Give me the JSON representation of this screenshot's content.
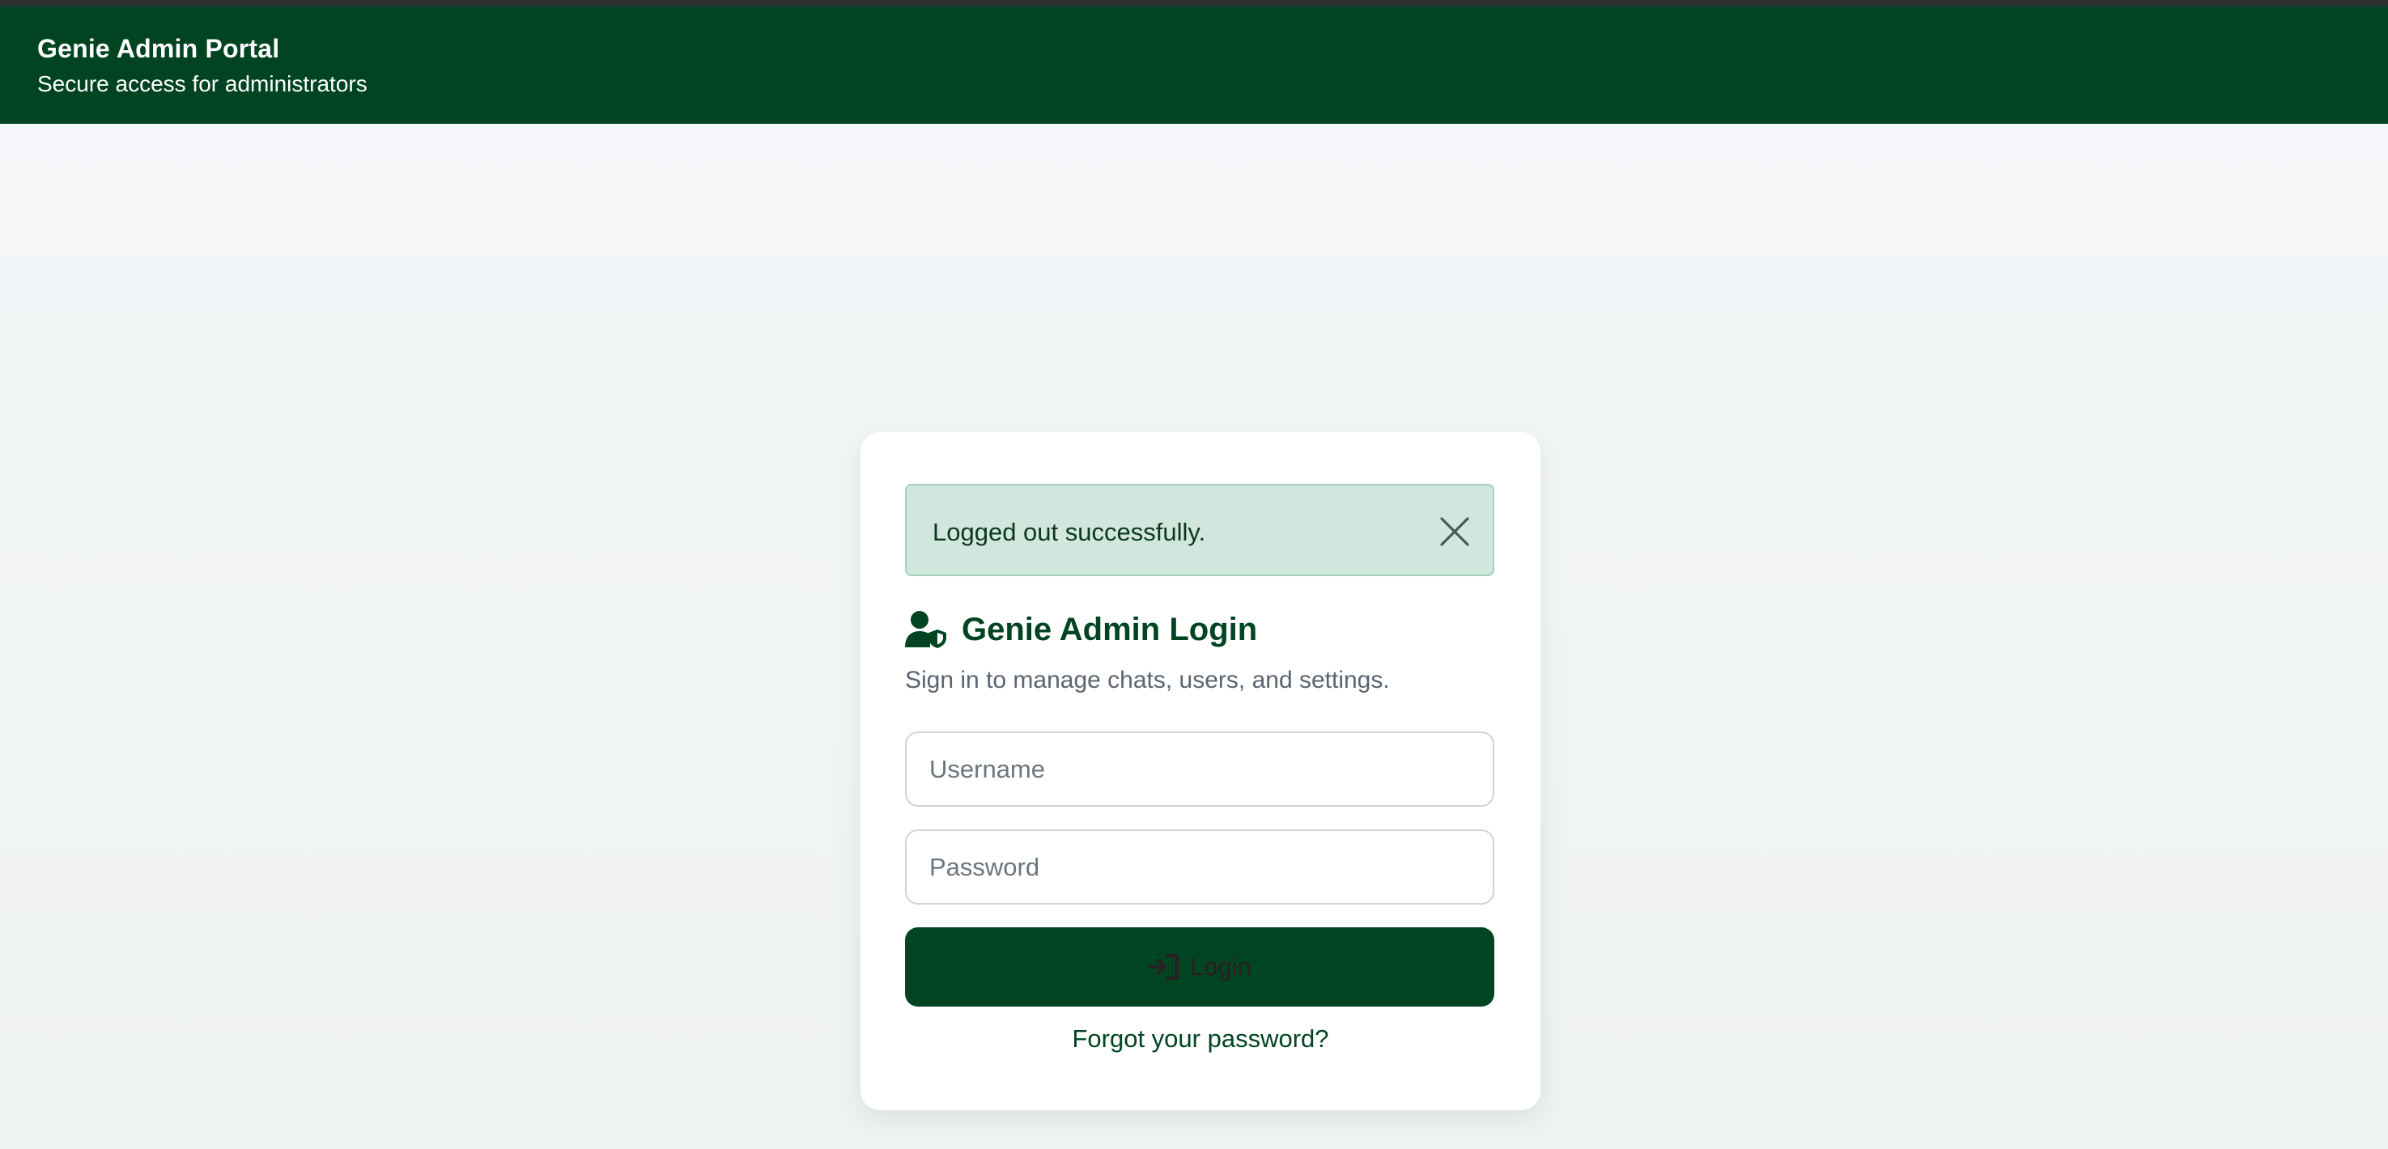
{
  "header": {
    "title": "Genie Admin Portal",
    "subtitle": "Secure access for administrators"
  },
  "alert": {
    "message": "Logged out successfully.",
    "close_icon": "close-icon"
  },
  "login_card": {
    "icon": "user-shield-icon",
    "title": "Genie Admin Login",
    "subtitle": "Sign in to manage chats, users, and settings.",
    "username_placeholder": "Username",
    "username_value": "",
    "password_placeholder": "Password",
    "password_value": "",
    "login_icon": "sign-in-icon",
    "login_label": "Login",
    "forgot_link": "Forgot your password?"
  },
  "colors": {
    "brand": "#004422",
    "alert_bg": "#d1e7dd",
    "alert_border": "#a3cfbb",
    "alert_text": "#0a3622"
  }
}
